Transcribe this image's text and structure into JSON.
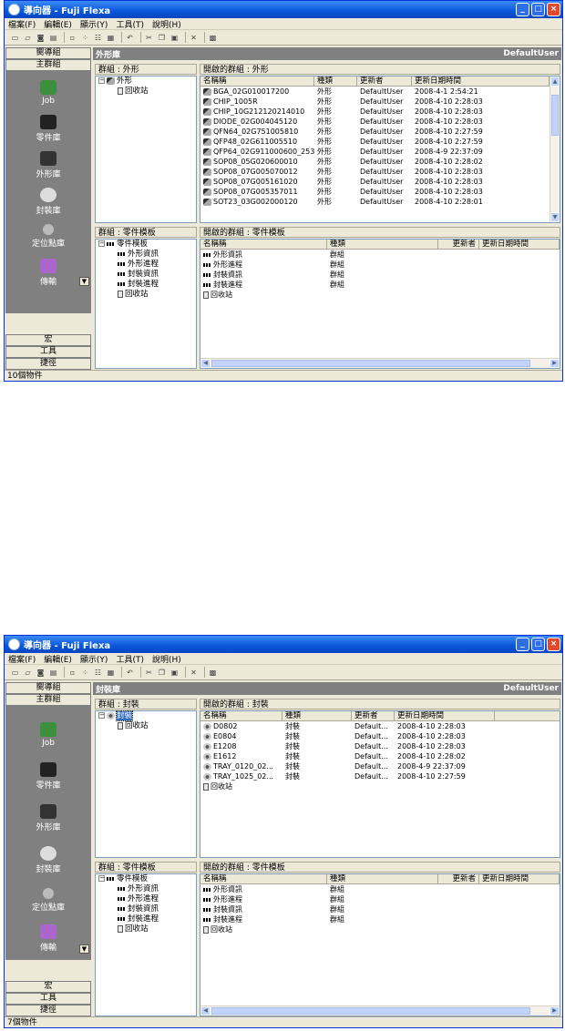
{
  "windows": [
    {
      "title": "導向器 - Fuji Flexa",
      "menu": [
        "檔案(F)",
        "編輯(E)",
        "顯示(Y)",
        "工具(T)",
        "說明(H)"
      ],
      "nav_top": [
        "嚮導組",
        "主群組"
      ],
      "nav_items": [
        "Job",
        "零件庫",
        "外形庫",
        "封裝庫",
        "定位點庫",
        "傳輸"
      ],
      "nav_bottom": [
        "宏",
        "工具",
        "捷徑"
      ],
      "section_title": "外形庫",
      "user": "DefaultUser",
      "upper_tree_header": "群組 : 外形",
      "upper_tree": [
        {
          "label": "外形",
          "level": 0
        },
        {
          "label": "回收站",
          "level": 1
        }
      ],
      "upper_grid_header": "開啟的群組 : 外形",
      "upper_columns": [
        "名稱稱",
        "種類",
        "更新者",
        "更新日期時間"
      ],
      "upper_rows": [
        [
          "BGA_02G010017200",
          "外形",
          "DefaultUser",
          "2008-4-1 2:54:21"
        ],
        [
          "CHIP_1005R",
          "外形",
          "DefaultUser",
          "2008-4-10 2:28:03"
        ],
        [
          "CHIP_10G212120214010",
          "外形",
          "DefaultUser",
          "2008-4-10 2:28:03"
        ],
        [
          "DIODE_02G004045120",
          "外形",
          "DefaultUser",
          "2008-4-10 2:28:03"
        ],
        [
          "QFN64_02G751005810",
          "外形",
          "DefaultUser",
          "2008-4-10 2:27:59"
        ],
        [
          "QFP48_02G611005510",
          "外形",
          "DefaultUser",
          "2008-4-10 2:27:59"
        ],
        [
          "QFP64_02G911000600_253",
          "外形",
          "DefaultUser",
          "2008-4-9 22:37:09"
        ],
        [
          "SOP08_05G020600010",
          "外形",
          "DefaultUser",
          "2008-4-10 2:28:02"
        ],
        [
          "SOP08_07G005070012",
          "外形",
          "DefaultUser",
          "2008-4-10 2:28:03"
        ],
        [
          "SOP08_07G005161020",
          "外形",
          "DefaultUser",
          "2008-4-10 2:28:03"
        ],
        [
          "SOP08_07G005357011",
          "外形",
          "DefaultUser",
          "2008-4-10 2:28:03"
        ],
        [
          "SOT23_03G002000120",
          "外形",
          "DefaultUser",
          "2008-4-10 2:28:01"
        ]
      ],
      "lower_tree_header": "群組 : 零件模板",
      "lower_tree": [
        {
          "label": "零件模板",
          "level": 0
        },
        {
          "label": "外形資訊",
          "level": 1
        },
        {
          "label": "外形進程",
          "level": 1
        },
        {
          "label": "封裝資訊",
          "level": 1
        },
        {
          "label": "封裝進程",
          "level": 1
        },
        {
          "label": "回收站",
          "level": 1
        }
      ],
      "lower_grid_header": "開啟的群組 : 零件模板",
      "lower_columns": [
        "名稱稱",
        "種類",
        "更新者",
        "更新日期時間"
      ],
      "lower_rows": [
        [
          "外形資訊",
          "群組",
          "",
          ""
        ],
        [
          "外形進程",
          "群組",
          "",
          ""
        ],
        [
          "封裝資訊",
          "群組",
          "",
          ""
        ],
        [
          "封裝進程",
          "群組",
          "",
          ""
        ],
        [
          "回收站",
          "",
          "",
          ""
        ]
      ],
      "status": "10個物件"
    },
    {
      "title": "導向器 - Fuji Flexa",
      "menu": [
        "檔案(F)",
        "編輯(E)",
        "顯示(Y)",
        "工具(T)",
        "說明(H)"
      ],
      "nav_top": [
        "嚮導組",
        "主群組"
      ],
      "nav_items": [
        "Job",
        "零件庫",
        "外形庫",
        "封裝庫",
        "定位點庫",
        "傳輸"
      ],
      "nav_bottom": [
        "宏",
        "工具",
        "捷徑"
      ],
      "section_title": "封裝庫",
      "user": "DefaultUser",
      "upper_tree_header": "群組 : 封裝",
      "upper_tree": [
        {
          "label": "封裝",
          "level": 0
        },
        {
          "label": "回收站",
          "level": 1
        }
      ],
      "upper_grid_header": "開啟的群組 : 封裝",
      "upper_columns": [
        "名稱稱",
        "種類",
        "更新者",
        "更新日期時間"
      ],
      "upper_rows": [
        [
          "D0802",
          "封裝",
          "Default...",
          "2008-4-10 2:28:03"
        ],
        [
          "E0804",
          "封裝",
          "Default...",
          "2008-4-10 2:28:03"
        ],
        [
          "E1208",
          "封裝",
          "Default...",
          "2008-4-10 2:28:03"
        ],
        [
          "E1612",
          "封裝",
          "Default...",
          "2008-4-10 2:28:02"
        ],
        [
          "TRAY_0120_02...",
          "封裝",
          "Default...",
          "2008-4-9 22:37:09"
        ],
        [
          "TRAY_1025_02...",
          "封裝",
          "Default...",
          "2008-4-10 2:27:59"
        ],
        [
          "回收站",
          "",
          "",
          ""
        ]
      ],
      "lower_tree_header": "群組 : 零件模板",
      "lower_tree": [
        {
          "label": "零件模板",
          "level": 0
        },
        {
          "label": "外形資訊",
          "level": 1
        },
        {
          "label": "外形進程",
          "level": 1
        },
        {
          "label": "封裝資訊",
          "level": 1
        },
        {
          "label": "封裝進程",
          "level": 1
        },
        {
          "label": "回收站",
          "level": 1
        }
      ],
      "lower_grid_header": "開啟的群組 : 零件模板",
      "lower_columns": [
        "名稱稱",
        "種類",
        "更新者",
        "更新日期時間"
      ],
      "lower_rows": [
        [
          "外形資訊",
          "群組",
          "",
          ""
        ],
        [
          "外形進程",
          "群組",
          "",
          ""
        ],
        [
          "封裝資訊",
          "群組",
          "",
          ""
        ],
        [
          "封裝進程",
          "群組",
          "",
          ""
        ],
        [
          "回收站",
          "",
          "",
          ""
        ]
      ],
      "status": "7個物件"
    }
  ]
}
